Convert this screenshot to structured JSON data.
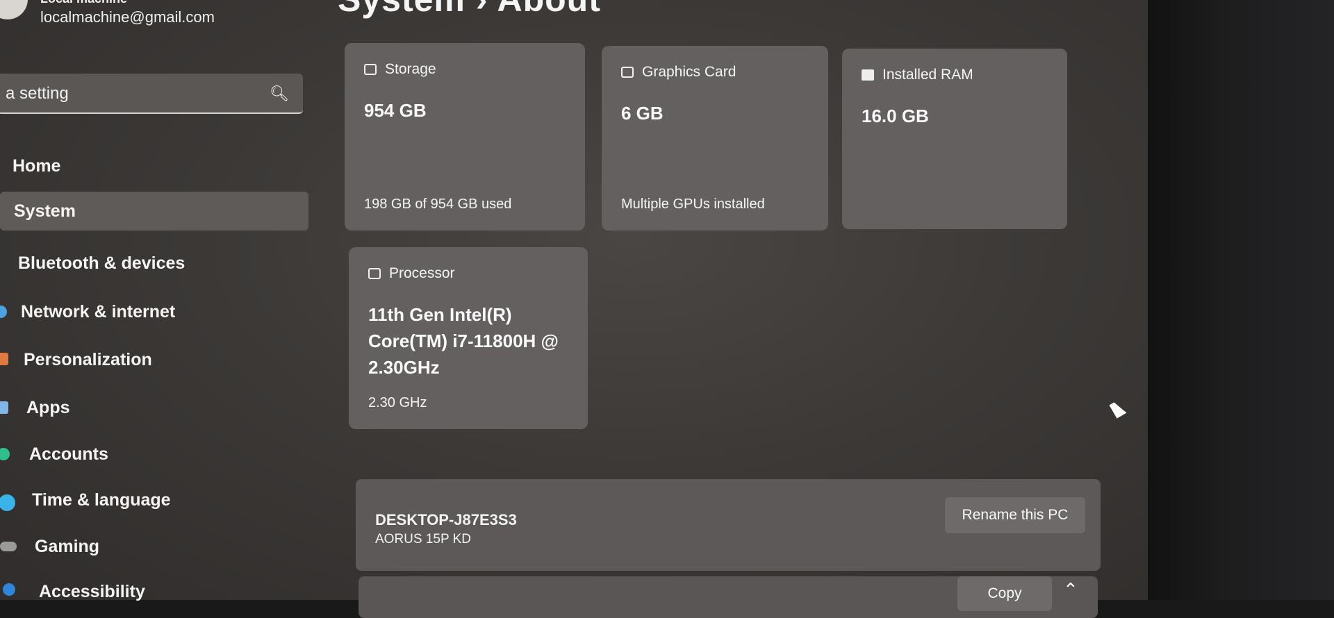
{
  "account": {
    "name": "Local machine",
    "email": "localmachine@gmail.com"
  },
  "search": {
    "text": "a setting"
  },
  "header": {
    "title": "System  ›  About"
  },
  "sidebar": {
    "items": [
      {
        "label": "Home"
      },
      {
        "label": "System"
      },
      {
        "label": "Bluetooth & devices"
      },
      {
        "label": "Network & internet"
      },
      {
        "label": "Personalization"
      },
      {
        "label": "Apps"
      },
      {
        "label": "Accounts"
      },
      {
        "label": "Time & language"
      },
      {
        "label": "Gaming"
      },
      {
        "label": "Accessibility"
      }
    ]
  },
  "specs": {
    "storage": {
      "title": "Storage",
      "value": "954 GB",
      "sub": "198 GB of 954 GB used"
    },
    "graphics": {
      "title": "Graphics Card",
      "value": "6 GB",
      "sub": "Multiple GPUs installed"
    },
    "ram": {
      "title": "Installed RAM",
      "value": "16.0 GB"
    },
    "processor": {
      "title": "Processor",
      "value": "11th Gen Intel(R) Core(TM) i7-11800H @ 2.30GHz",
      "sub": "2.30 GHz"
    }
  },
  "pc": {
    "name": "DESKTOP-J87E3S3",
    "model": "AORUS 15P KD",
    "rename_label": "Rename this PC"
  },
  "device_specs": {
    "copy_label": "Copy",
    "expand_icon": "chevron-up-icon"
  }
}
